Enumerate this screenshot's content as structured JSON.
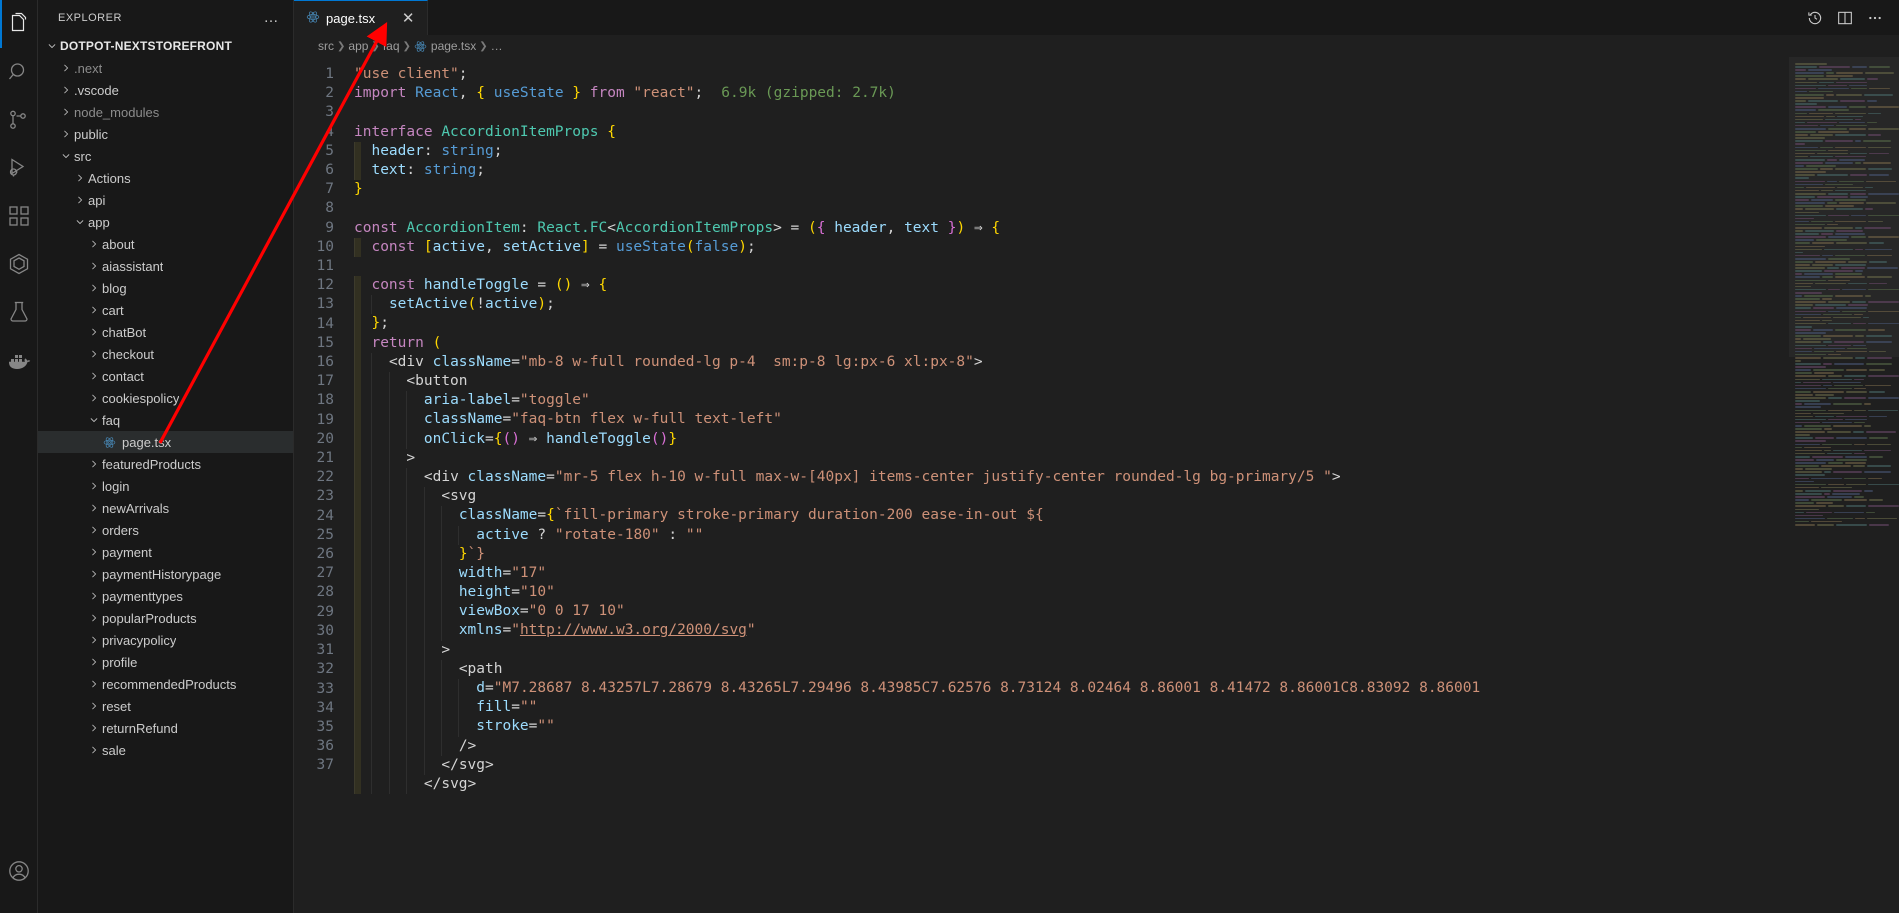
{
  "activitybar": {
    "items": [
      {
        "name": "explorer",
        "icon": "files-icon",
        "active": true
      },
      {
        "name": "search",
        "icon": "search-icon",
        "active": false
      },
      {
        "name": "source-control",
        "icon": "source-control-icon",
        "active": false
      },
      {
        "name": "run-and-debug",
        "icon": "run-debug-icon",
        "active": false
      },
      {
        "name": "extensions",
        "icon": "extensions-icon",
        "active": false
      },
      {
        "name": "remote-explorer",
        "icon": "remote-explorer-icon",
        "active": false
      },
      {
        "name": "testing",
        "icon": "beaker-icon",
        "active": false
      },
      {
        "name": "docker",
        "icon": "docker-icon",
        "active": false
      }
    ],
    "bottom": [
      {
        "name": "accounts",
        "icon": "account-icon"
      }
    ]
  },
  "sidebar": {
    "header": "EXPLORER",
    "more_actions": "…",
    "root": {
      "label": "DOTPOT-NEXTSTOREFRONT",
      "expanded": true
    },
    "items": [
      {
        "label": ".next",
        "depth": 1,
        "type": "folder",
        "expanded": false,
        "dim": true
      },
      {
        "label": ".vscode",
        "depth": 1,
        "type": "folder",
        "expanded": false,
        "dim": false
      },
      {
        "label": "node_modules",
        "depth": 1,
        "type": "folder",
        "expanded": false,
        "dim": true
      },
      {
        "label": "public",
        "depth": 1,
        "type": "folder",
        "expanded": false,
        "dim": false
      },
      {
        "label": "src",
        "depth": 1,
        "type": "folder",
        "expanded": true,
        "dim": false
      },
      {
        "label": "Actions",
        "depth": 2,
        "type": "folder",
        "expanded": false,
        "dim": false
      },
      {
        "label": "api",
        "depth": 2,
        "type": "folder",
        "expanded": false,
        "dim": false
      },
      {
        "label": "app",
        "depth": 2,
        "type": "folder",
        "expanded": true,
        "dim": false
      },
      {
        "label": "about",
        "depth": 3,
        "type": "folder",
        "expanded": false,
        "dim": false
      },
      {
        "label": "aiassistant",
        "depth": 3,
        "type": "folder",
        "expanded": false,
        "dim": false
      },
      {
        "label": "blog",
        "depth": 3,
        "type": "folder",
        "expanded": false,
        "dim": false
      },
      {
        "label": "cart",
        "depth": 3,
        "type": "folder",
        "expanded": false,
        "dim": false
      },
      {
        "label": "chatBot",
        "depth": 3,
        "type": "folder",
        "expanded": false,
        "dim": false
      },
      {
        "label": "checkout",
        "depth": 3,
        "type": "folder",
        "expanded": false,
        "dim": false
      },
      {
        "label": "contact",
        "depth": 3,
        "type": "folder",
        "expanded": false,
        "dim": false
      },
      {
        "label": "cookiespolicy",
        "depth": 3,
        "type": "folder",
        "expanded": false,
        "dim": false
      },
      {
        "label": "faq",
        "depth": 3,
        "type": "folder",
        "expanded": true,
        "dim": false
      },
      {
        "label": "page.tsx",
        "depth": 4,
        "type": "react-file",
        "selected": true,
        "dim": false
      },
      {
        "label": "featuredProducts",
        "depth": 3,
        "type": "folder",
        "expanded": false,
        "dim": false
      },
      {
        "label": "login",
        "depth": 3,
        "type": "folder",
        "expanded": false,
        "dim": false
      },
      {
        "label": "newArrivals",
        "depth": 3,
        "type": "folder",
        "expanded": false,
        "dim": false
      },
      {
        "label": "orders",
        "depth": 3,
        "type": "folder",
        "expanded": false,
        "dim": false
      },
      {
        "label": "payment",
        "depth": 3,
        "type": "folder",
        "expanded": false,
        "dim": false
      },
      {
        "label": "paymentHistorypage",
        "depth": 3,
        "type": "folder",
        "expanded": false,
        "dim": false
      },
      {
        "label": "paymenttypes",
        "depth": 3,
        "type": "folder",
        "expanded": false,
        "dim": false
      },
      {
        "label": "popularProducts",
        "depth": 3,
        "type": "folder",
        "expanded": false,
        "dim": false
      },
      {
        "label": "privacypolicy",
        "depth": 3,
        "type": "folder",
        "expanded": false,
        "dim": false
      },
      {
        "label": "profile",
        "depth": 3,
        "type": "folder",
        "expanded": false,
        "dim": false
      },
      {
        "label": "recommendedProducts",
        "depth": 3,
        "type": "folder",
        "expanded": false,
        "dim": false
      },
      {
        "label": "reset",
        "depth": 3,
        "type": "folder",
        "expanded": false,
        "dim": false
      },
      {
        "label": "returnRefund",
        "depth": 3,
        "type": "folder",
        "expanded": false,
        "dim": false
      },
      {
        "label": "sale",
        "depth": 3,
        "type": "folder",
        "expanded": false,
        "dim": false
      }
    ]
  },
  "editor": {
    "tab": {
      "label": "page.tsx",
      "icon": "react-icon",
      "close": "✕",
      "active": true
    },
    "tab_actions": [
      {
        "name": "timeline-icon",
        "glyph": "history"
      },
      {
        "name": "split-editor-icon",
        "glyph": "split"
      },
      {
        "name": "more-actions-icon",
        "glyph": "ellipsis"
      }
    ],
    "breadcrumbs": [
      "src",
      "app",
      "faq",
      "page.tsx",
      "…"
    ],
    "inline_hint": "6.9k (gzipped: 2.7k)",
    "first_line": 1,
    "last_line": 37,
    "lines": [
      "\"use client\";",
      "import React, { useState } from \"react\";",
      "",
      "interface AccordionItemProps {",
      "  header: string;",
      "  text: string;",
      "}",
      "",
      "const AccordionItem: React.FC<AccordionItemProps> = ({ header, text }) ⇒ {",
      "  const [active, setActive] = useState(false);",
      "",
      "  const handleToggle = () ⇒ {",
      "    setActive(!active);",
      "  };",
      "  return (",
      "    <div className=\"mb-8 w-full rounded-lg p-4  sm:p-8 lg:px-6 xl:px-8\">",
      "      <button",
      "        aria-label=\"toggle\"",
      "        className=\"faq-btn flex w-full text-left\"",
      "        onClick={() ⇒ handleToggle()}",
      "      >",
      "        <div className=\"mr-5 flex h-10 w-full max-w-[40px] items-center justify-center rounded-lg bg-primary/5 \">",
      "          <svg",
      "            className={`fill-primary stroke-primary duration-200 ease-in-out ${",
      "              active ? \"rotate-180\" : \"\"",
      "            }`}",
      "            width=\"17\"",
      "            height=\"10\"",
      "            viewBox=\"0 0 17 10\"",
      "            xmlns=\"http://www.w3.org/2000/svg\"",
      "          >",
      "            <path",
      "              d=\"M7.28687 8.43257L7.28679 8.43265L7.29496 8.43985C7.62576 8.73124 8.02464 8.86001 8.41472 8.86001C8.83092 8.86001",
      "              fill=\"\"",
      "              stroke=\"\"",
      "            />",
      "          </svg>",
      "        </svg>"
    ]
  },
  "colors": {
    "accent": "#0078d4",
    "editor_bg": "#1f1f1f",
    "sidebar_bg": "#181818",
    "activitybar_bg": "#181818",
    "selection_bg": "#2a2d2e",
    "annotation_arrow": "#ff0000",
    "string": "#ce9178",
    "keyword": "#c586c0",
    "type": "#4ec9b0",
    "variable": "#9cdcfe",
    "function": "#dcdcaa",
    "number": "#b5cea8",
    "comment": "#6a9955"
  }
}
